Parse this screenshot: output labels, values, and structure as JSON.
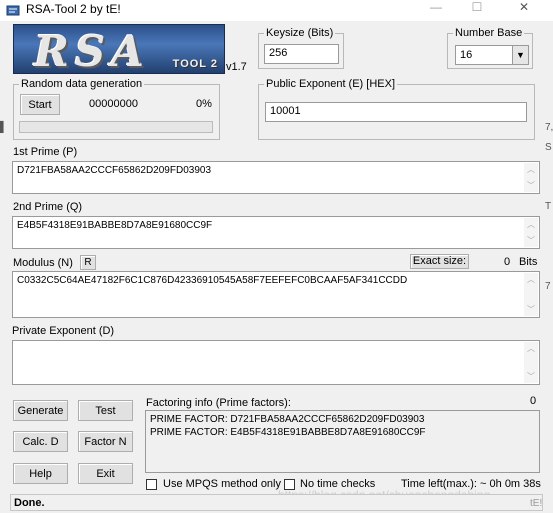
{
  "window": {
    "title": "RSA-Tool 2 by tE!",
    "minimize_label": "—",
    "maximize_label": "☐",
    "close_label": "✕"
  },
  "logo": {
    "main": "RSA",
    "sub": "TOOL 2"
  },
  "version": "v1.7",
  "keysize": {
    "label": "Keysize (Bits)",
    "value": "256"
  },
  "number_base": {
    "label": "Number Base",
    "value": "16"
  },
  "random": {
    "label": "Random data generation",
    "start_label": "Start",
    "counter": "00000000",
    "percent": "0%",
    "progress": 0
  },
  "public_exponent": {
    "label": "Public Exponent (E) [HEX]",
    "value": "10001"
  },
  "prime_p": {
    "label": "1st Prime (P)",
    "value": "D721FBA58AA2CCCF65862D209FD03903"
  },
  "prime_q": {
    "label": "2nd Prime (Q)",
    "value": "E4B5F4318E91BABBE8D7A8E91680CC9F"
  },
  "modulus": {
    "label": "Modulus (N)",
    "r_button": "R",
    "exact_size_label": "Exact size:",
    "exact_size_value": "0",
    "bits_label": "Bits",
    "value": "C0332C5C64AE47182F6C1C876D42336910545A58F7EEFEFC0BCAAF5AF341CCDD"
  },
  "private_exponent": {
    "label": "Private Exponent (D)",
    "value": ""
  },
  "buttons": {
    "generate": "Generate",
    "test": "Test",
    "calc_d": "Calc. D",
    "factor_n": "Factor N",
    "help": "Help",
    "exit": "Exit"
  },
  "factoring": {
    "label": "Factoring info (Prime factors):",
    "count": "0",
    "lines": [
      "PRIME FACTOR: D721FBA58AA2CCCF65862D209FD03903",
      "PRIME FACTOR: E4B5F4318E91BABBE8D7A8E91680CC9F"
    ]
  },
  "options": {
    "mpqs_label": "Use MPQS method only",
    "mpqs_checked": false,
    "no_time_label": "No time checks",
    "no_time_checked": false,
    "time_left": "Time left(max.): ~ 0h 0m 38s"
  },
  "status": {
    "text": "Done.",
    "right": "tE!"
  },
  "watermark": "https://blog.csdn.net/chuanchengdabing"
}
